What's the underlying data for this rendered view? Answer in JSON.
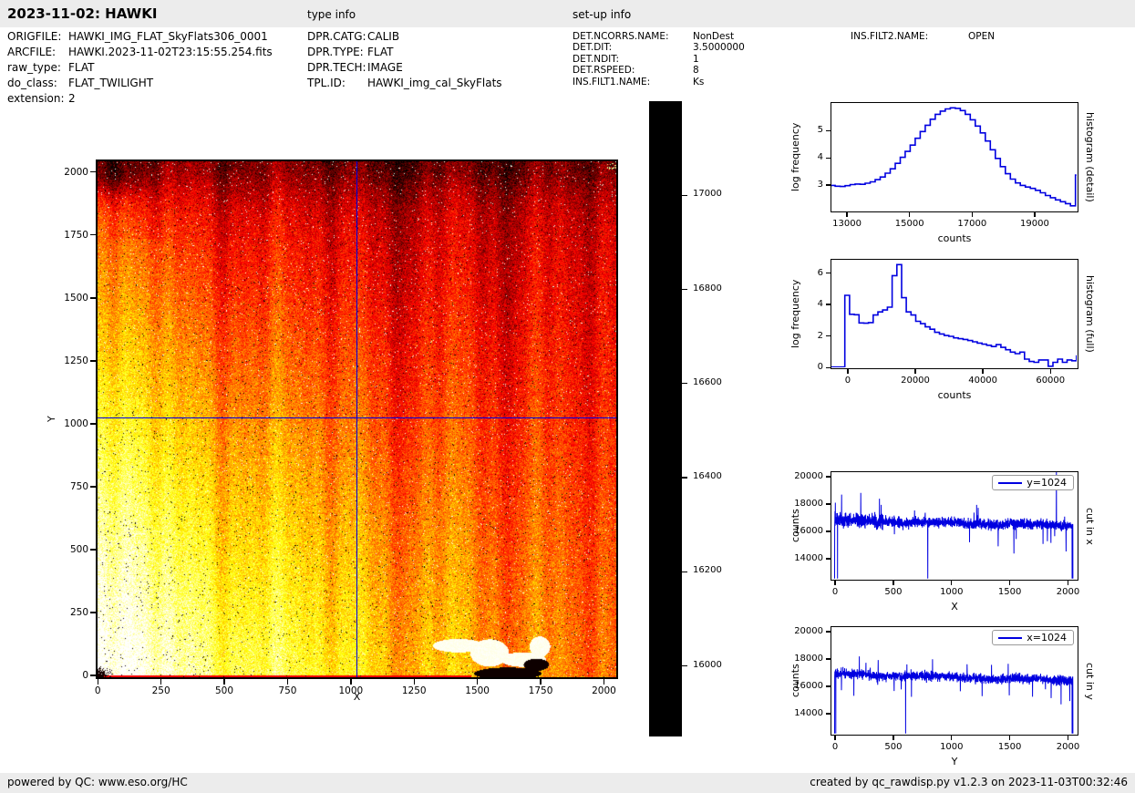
{
  "header": {
    "title": "2023-11-02: HAWKI",
    "type_info_label": "type info",
    "setup_info_label": "set-up info"
  },
  "file_info": {
    "rows": [
      {
        "label": "ORIGFILE:",
        "value": "HAWKI_IMG_FLAT_SkyFlats306_0001"
      },
      {
        "label": "ARCFILE:",
        "value": "HAWKI.2023-11-02T23:15:55.254.fits"
      },
      {
        "label": "raw_type:",
        "value": "FLAT"
      },
      {
        "label": "do_class:",
        "value": "FLAT_TWILIGHT"
      },
      {
        "label": "extension:",
        "value": "2"
      }
    ]
  },
  "type_info": {
    "rows": [
      {
        "label": "DPR.CATG:",
        "value": "CALIB"
      },
      {
        "label": "DPR.TYPE:",
        "value": "FLAT"
      },
      {
        "label": "DPR.TECH:",
        "value": "IMAGE"
      },
      {
        "label": "TPL.ID:",
        "value": "HAWKI_img_cal_SkyFlats"
      }
    ]
  },
  "setup_info": {
    "col1": [
      {
        "label": "DET.NCORRS.NAME:",
        "value": "NonDest"
      },
      {
        "label": "DET.DIT:",
        "value": "3.5000000"
      },
      {
        "label": "DET.NDIT:",
        "value": "1"
      },
      {
        "label": "DET.RSPEED:",
        "value": "8"
      },
      {
        "label": "INS.FILT1.NAME:",
        "value": "Ks"
      }
    ],
    "col2": [
      {
        "label": "INS.FILT2.NAME:",
        "value": "OPEN"
      }
    ]
  },
  "footer": {
    "left": "powered by QC: www.eso.org/HC",
    "right": "created by qc_rawdisp.py v1.2.3 on 2023-11-03T00:32:46"
  },
  "colors": {
    "line_blue": "#0000e0",
    "bar_bg": "#ececec",
    "black": "#000000"
  },
  "chart_data": [
    {
      "id": "main_image",
      "type": "heatmap",
      "xlabel": "X",
      "ylabel": "Y",
      "xlim": [
        -8,
        2056
      ],
      "ylim": [
        -15,
        2050
      ],
      "xticks": [
        0,
        250,
        500,
        750,
        1000,
        1250,
        1500,
        1750,
        2000
      ],
      "yticks": [
        0,
        250,
        500,
        750,
        1000,
        1250,
        1500,
        1750,
        2000
      ],
      "colormap": "hot",
      "vmin": 15850,
      "vmax": 17200,
      "crosshair": {
        "x": 1024,
        "y": 1024
      },
      "detector_size": [
        2048,
        2048
      ],
      "seed": 20231102,
      "features": {
        "bright_region": "lower-left quadrant near 17100 counts (white)",
        "dark_region": "top rows near 16000 counts (dark red/black)",
        "vertical_banding": true,
        "saturated_white_blob": {
          "x": 1560,
          "y": 90
        },
        "dead_black_blob": {
          "x": 1620,
          "y": 25
        },
        "dead_corner": {
          "x": 15,
          "y": 10
        }
      }
    },
    {
      "id": "colorbar",
      "type": "colorbar",
      "vmin": 15850,
      "vmax": 17200,
      "ticks": [
        16000,
        16200,
        16400,
        16600,
        16800,
        17000
      ]
    },
    {
      "id": "hist_detail",
      "type": "step",
      "right_label": "histogram (detail)",
      "xlabel": "counts",
      "ylabel": "log frequency",
      "xlim": [
        12475,
        20400
      ],
      "ylim": [
        2.0,
        6.05
      ],
      "xticks": [
        13000,
        15000,
        17000,
        19000
      ],
      "yticks": [
        3,
        4,
        5
      ],
      "bin_start": 12480,
      "bin_width": 160,
      "values": [
        2.97,
        2.94,
        2.93,
        2.96,
        3.0,
        3.02,
        3.01,
        3.05,
        3.1,
        3.18,
        3.28,
        3.42,
        3.58,
        3.78,
        4.0,
        4.22,
        4.45,
        4.7,
        4.95,
        5.18,
        5.4,
        5.58,
        5.7,
        5.78,
        5.82,
        5.8,
        5.72,
        5.58,
        5.38,
        5.15,
        4.9,
        4.6,
        4.28,
        3.96,
        3.66,
        3.4,
        3.2,
        3.06,
        2.97,
        2.91,
        2.86,
        2.79,
        2.7,
        2.6,
        2.52,
        2.44,
        2.37,
        2.3,
        2.22,
        3.35
      ]
    },
    {
      "id": "hist_full",
      "type": "step",
      "right_label": "histogram (full)",
      "xlabel": "counts",
      "ylabel": "log frequency",
      "xlim": [
        -5100,
        68300
      ],
      "ylim": [
        -0.1,
        6.9
      ],
      "xticks": [
        0,
        20000,
        40000,
        60000
      ],
      "yticks": [
        0,
        2,
        4,
        6
      ],
      "bin_start": -4900,
      "bin_width": 1400,
      "values": [
        0,
        0,
        0,
        4.55,
        3.35,
        3.32,
        2.8,
        2.78,
        2.82,
        3.3,
        3.5,
        3.62,
        3.8,
        5.8,
        6.5,
        4.4,
        3.5,
        3.3,
        2.9,
        2.75,
        2.55,
        2.4,
        2.2,
        2.1,
        2.0,
        1.95,
        1.85,
        1.8,
        1.75,
        1.68,
        1.6,
        1.52,
        1.45,
        1.38,
        1.3,
        1.42,
        1.25,
        1.1,
        0.95,
        0.85,
        0.95,
        0.5,
        0.35,
        0.3,
        0.45,
        0.45,
        0.05,
        0.3,
        0.5,
        0.3,
        0.45,
        0.4,
        0.75
      ]
    },
    {
      "id": "cut_x",
      "type": "noisy_line",
      "right_label": "cut in x",
      "xlabel": "X",
      "ylabel": "counts",
      "legend": "y=1024",
      "xlim": [
        -40,
        2090
      ],
      "ylim": [
        12400,
        20400
      ],
      "xticks": [
        0,
        500,
        1000,
        1500,
        2000
      ],
      "yticks": [
        14000,
        16000,
        18000,
        20000
      ],
      "n": 2048,
      "seed": 77031,
      "base_start": 16760,
      "base_end": 16380,
      "noise": 230,
      "hv_end": 420,
      "hv_gain": 1.5,
      "spikes": [
        [
          25,
          12430
        ],
        [
          60,
          18650
        ],
        [
          225,
          18780
        ],
        [
          385,
          18350
        ],
        [
          400,
          17900
        ],
        [
          800,
          12450
        ],
        [
          1220,
          17900
        ],
        [
          1540,
          14350
        ],
        [
          1560,
          15400
        ],
        [
          1790,
          15050
        ],
        [
          1905,
          20380
        ],
        [
          2040,
          12450
        ]
      ]
    },
    {
      "id": "cut_y",
      "type": "noisy_line",
      "right_label": "cut in y",
      "xlabel": "Y",
      "ylabel": "counts",
      "legend": "x=1024",
      "xlim": [
        -40,
        2090
      ],
      "ylim": [
        12400,
        20400
      ],
      "xticks": [
        0,
        500,
        1000,
        1500,
        2000
      ],
      "yticks": [
        14000,
        16000,
        18000,
        20000
      ],
      "n": 2048,
      "seed": 90217,
      "base_start": 16870,
      "base_end": 16380,
      "noise": 210,
      "hv_end": 0,
      "hv_gain": 1,
      "spikes": [
        [
          10,
          12500
        ],
        [
          610,
          12500
        ],
        [
          1080,
          15600
        ],
        [
          1500,
          15300
        ],
        [
          1700,
          15200
        ],
        [
          1860,
          15100
        ],
        [
          1945,
          14650
        ],
        [
          2040,
          12500
        ]
      ]
    }
  ]
}
